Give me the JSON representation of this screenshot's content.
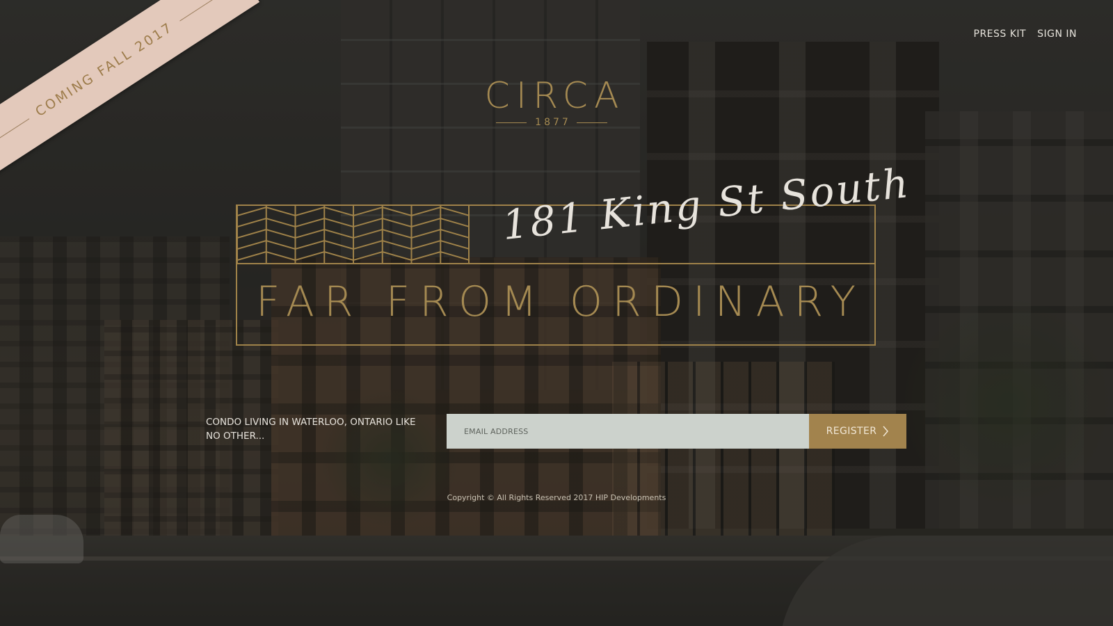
{
  "ribbon": {
    "text": "COMING FALL 2017"
  },
  "nav": {
    "press_kit": "PRESS KIT",
    "sign_in": "SIGN IN"
  },
  "logo": {
    "word": "CIRCA",
    "year": "1877"
  },
  "headline": {
    "address": "181 King St South",
    "tagline": "FAR FROM ORDINARY"
  },
  "register": {
    "intro": "CONDO LIVING IN WATERLOO, ONTARIO LIKE NO OTHER...",
    "email_placeholder": "EMAIL ADDRESS",
    "email_value": "",
    "button_label": "REGISTER",
    "button_icon": "chevron-right-icon"
  },
  "footer": {
    "copyright": "Copyright © All Rights Reserved 2017 HIP Developments"
  },
  "colors": {
    "gold": "#a58a52",
    "ribbon": "#e3c9bb",
    "input_bg": "#ccd2cc",
    "button_bg": "#a2834d",
    "text_light": "#e7e3dc"
  }
}
